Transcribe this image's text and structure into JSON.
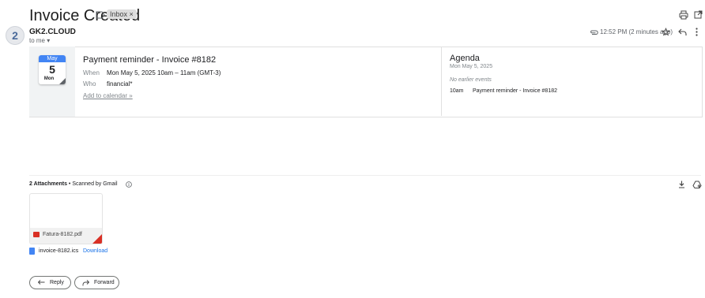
{
  "header": {
    "subject": "Invoice Created",
    "label_chip": "Inbox ×"
  },
  "sender": {
    "avatar_text": "2",
    "name": "GK2.CLOUD",
    "to_line": "to me ▾",
    "time": "12:52 PM (2 minutes ago)"
  },
  "invite": {
    "cal_month": "May",
    "cal_day": "5",
    "cal_dow": "Mon",
    "title": "Payment reminder - Invoice #8182",
    "when_label": "When",
    "when_value": "Mon May 5, 2025 10am – 11am (GMT-3)",
    "who_label": "Who",
    "who_value": "financial*",
    "add_calendar": "Add to calendar »"
  },
  "agenda": {
    "title": "Agenda",
    "date": "Mon May 5, 2025",
    "no_earlier": "No earlier events",
    "event_time": "10am",
    "event_title": "Payment reminder - Invoice #8182"
  },
  "attachments": {
    "count_label": "2 Attachments",
    "scanned": " •  Scanned by Gmail",
    "pdf_name": "Fatura-8182.pdf",
    "ics_name": "invoice-8182.ics",
    "ics_download": "Download"
  },
  "actions": {
    "reply": "Reply",
    "forward": "Forward"
  },
  "colors": {
    "accent_blue": "#4285f4",
    "link_blue": "#1a73e8",
    "pdf_red": "#d93025"
  },
  "icons": [
    "label-icon",
    "print-icon",
    "open-in-new-window-icon",
    "attachment-icon",
    "star-icon",
    "reply-icon",
    "more-vert-icon",
    "info-icon",
    "download-icon",
    "add-to-drive-icon",
    "pdf-icon",
    "file-icon",
    "forward-icon"
  ]
}
